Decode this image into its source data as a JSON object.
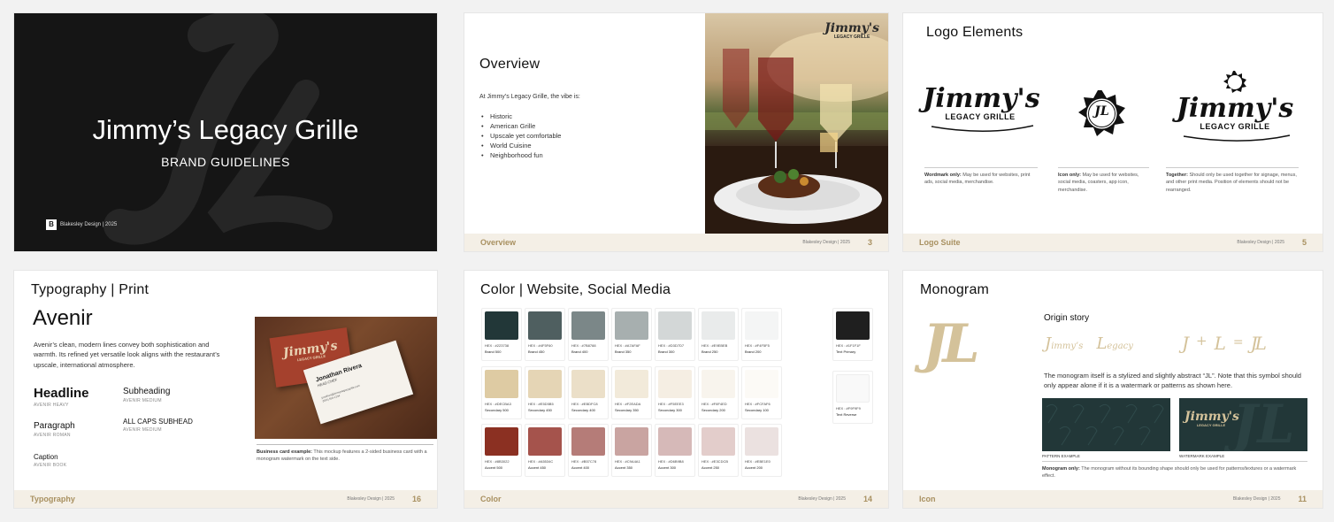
{
  "slide1": {
    "title": "Jimmy’s Legacy Grille",
    "subtitle": "BRAND GUIDELINES",
    "credit": "Blakesley Design | 2025",
    "credit_logo": "B",
    "bg_color": "#151515"
  },
  "slide3": {
    "title": "Overview",
    "intro": "At Jimmy’s Legacy Grille, the vibe is:",
    "bullets": [
      "Historic",
      "American Grille",
      "Upscale yet comfortable",
      "World Cuisine",
      "Neighborhood fun"
    ],
    "photo_logo_main": "Jimmy's",
    "photo_logo_sub": "LEGACY GRILLE",
    "footer": {
      "section": "Overview",
      "meta": "Blakesley Design | 2025",
      "page": "3"
    }
  },
  "slide5": {
    "title": "Logo Elements",
    "wordmark_main": "Jimmy's",
    "wordmark_sub": "LEGACY GRILLE",
    "icon_letters": "JL",
    "captions": [
      {
        "label": "Wordmark only:",
        "text": "May be used for websites, print ads, social media, merchandise."
      },
      {
        "label": "Icon only:",
        "text": "May be used for websites, social media, coasters, app icon, merchandise."
      },
      {
        "label": "Together:",
        "text": "Should only be used together for signage, menus, and other print media. Position of elements should not be rearranged."
      }
    ],
    "footer": {
      "section": "Logo Suite",
      "meta": "Blakesley Design | 2025",
      "page": "5"
    }
  },
  "slide16": {
    "title": "Typography | Print",
    "font_name": "Avenir",
    "description": "Avenir’s clean, modern lines convey both sophistication and warmth. Its refined yet versatile look aligns with the restaurant’s upscale, international atmosphere.",
    "styles_left": [
      {
        "sample": "Headline",
        "weight": "AVENIR HEAVY"
      },
      {
        "sample": "Paragraph",
        "weight": "AVENIR ROMAN"
      },
      {
        "sample": "Caption",
        "weight": "AVENIR BOOK"
      }
    ],
    "styles_right": [
      {
        "sample": "Subheading",
        "weight": "AVENIR MEDIUM"
      },
      {
        "sample": "ALL CAPS SUBHEAD",
        "weight": "AVENIR MEDIUM"
      }
    ],
    "card_logo_main": "Jimmy's",
    "card_logo_sub": "LEGACY GRILLE",
    "card_name": "Jonathan Rivera",
    "card_role": "HEAD CHEF",
    "card_email": "jonathan@jimmyslegacygrille.com",
    "card_phone": "(555) 555-1234",
    "mockup_label": "Business card example:",
    "mockup_text": "This mockup features a 2-sided business card with a monogram watermark on the text side.",
    "footer": {
      "section": "Typography",
      "meta": "Blakesley Design | 2025",
      "page": "16"
    }
  },
  "slide14": {
    "title": "Color | Website, Social Media",
    "rows": [
      [
        {
          "color": "#223738",
          "hex": "HEX : #223738",
          "name": "Brand 500"
        },
        {
          "color": "#4F5F60",
          "hex": "HEX : #4F5F60",
          "name": "Brand 450"
        },
        {
          "color": "#7B8788",
          "hex": "HEX : #7B8788",
          "name": "Brand 400"
        },
        {
          "color": "#A7AFAF",
          "hex": "HEX : #A7AFAF",
          "name": "Brand 350"
        },
        {
          "color": "#D3D7D7",
          "hex": "HEX : #D3D7D7",
          "name": "Brand 300"
        },
        {
          "color": "#E9EBEB",
          "hex": "HEX : #E9EBEB",
          "name": "Brand 250"
        },
        {
          "color": "#F4F5F5",
          "hex": "HEX : #F4F5F5",
          "name": "Brand 200"
        }
      ],
      [
        {
          "color": "#DECBA3",
          "hex": "HEX : #DECBA3",
          "name": "Secondary 500"
        },
        {
          "color": "#E5D5B5",
          "hex": "HEX : #E5D5B5",
          "name": "Secondary 450"
        },
        {
          "color": "#EBDFC8",
          "hex": "HEX : #EBDFC8",
          "name": "Secondary 400"
        },
        {
          "color": "#F2EADA",
          "hex": "HEX : #F2EADA",
          "name": "Secondary 350"
        },
        {
          "color": "#F5EEE3",
          "hex": "HEX : #F5EEE3",
          "name": "Secondary 300"
        },
        {
          "color": "#F8F4ED",
          "hex": "HEX : #F8F4ED",
          "name": "Secondary 200"
        },
        {
          "color": "#FCFAF6",
          "hex": "HEX : #FCFAF6",
          "name": "Secondary 100"
        }
      ],
      [
        {
          "color": "#8B3022",
          "hex": "HEX : #8B3022",
          "name": "Accent 500"
        },
        {
          "color": "#A5534C",
          "hex": "HEX : #A5534C",
          "name": "Accent 450"
        },
        {
          "color": "#B57C78",
          "hex": "HEX : #B57C78",
          "name": "Accent 400"
        },
        {
          "color": "#C9A4A1",
          "hex": "HEX : #C9A4A1",
          "name": "Accent 350"
        },
        {
          "color": "#D6B9B8",
          "hex": "HEX : #D6B9B8",
          "name": "Accent 300"
        },
        {
          "color": "#E3CDCB",
          "hex": "HEX : #E3CDCB",
          "name": "Accent 250"
        },
        {
          "color": "#EBE1E0",
          "hex": "HEX : #EBE1E0",
          "name": "Accent 200"
        }
      ]
    ],
    "text_colors": [
      {
        "color": "#1F1F1F",
        "hex": "HEX : #1F1F1F",
        "name": "Text Primary"
      },
      {
        "color": "#F9F9F9",
        "hex": "HEX : #F9F9F9",
        "name": "Text Reverse"
      }
    ],
    "footer": {
      "section": "Color",
      "meta": "Blakesley Design | 2025",
      "page": "14"
    }
  },
  "slide11": {
    "title": "Monogram",
    "monogram": "JL",
    "story_title": "Origin story",
    "story_j": "J",
    "story_immy": "immy’s",
    "story_l": "L",
    "story_egacy": "egacy",
    "eq_j": "J",
    "eq_plus": "+",
    "eq_l": "L",
    "eq_equals": "=",
    "eq_result": "JL",
    "description": "The monogram itself is a stylized and slightly abstract “JL”. Note that this symbol should only appear alone if it is a watermark or patterns as shown here.",
    "pattern_label": "PATTERN EXAMPLE",
    "watermark_label": "WATERMARK EXAMPLE",
    "watermark_logo_main": "Jimmy's",
    "watermark_logo_sub": "LEGACY GRILLE",
    "note_label": "Monogram only:",
    "note_text": "The monogram without its bounding shape should only be used for patterns/textures or a watermark effect.",
    "footer": {
      "section": "Icon",
      "meta": "Blakesley Design | 2025",
      "page": "11"
    },
    "gold": "#D4C29A",
    "dark_green": "#223738"
  }
}
